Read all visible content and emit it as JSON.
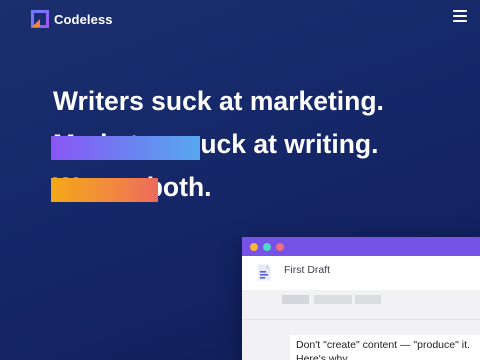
{
  "header": {
    "brand_name": "Codeless",
    "logo_icon": "codeless-logo-icon",
    "menu_icon": "hamburger-menu-icon"
  },
  "hero": {
    "lines": [
      "Writers suck at marketing.",
      "Marketers suck at writing.",
      "We get both."
    ],
    "highlight_colors": {
      "line_2": [
        "#8a55f5",
        "#58a8f0"
      ],
      "line_3": [
        "#f2a818",
        "#ec6a5c"
      ]
    }
  },
  "editor": {
    "window_dots": [
      "#f6b63a",
      "#4fd8c8",
      "#f07080"
    ],
    "titlebar_color": "#7652e6",
    "document_icon": "document-icon",
    "document_title": "First Draft",
    "body_text": "Don't \"create\" content — \"produce\" it. Here's why."
  }
}
